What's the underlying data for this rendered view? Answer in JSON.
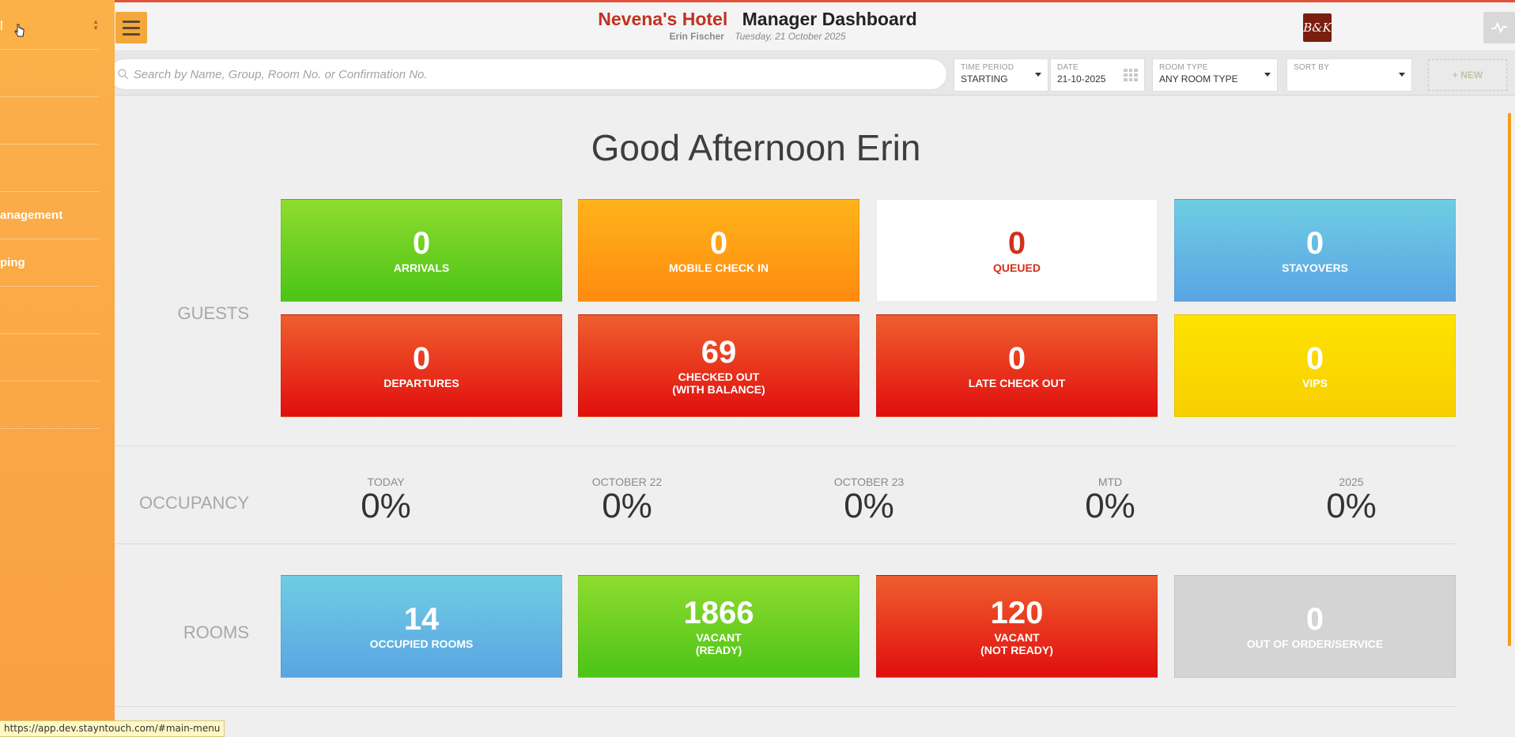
{
  "header": {
    "hotel_name": "Nevena's Hotel",
    "title": "Manager Dashboard",
    "user": "Erin Fischer",
    "date": "Tuesday, 21 October 2025",
    "logo_text": "B&K"
  },
  "toolbar": {
    "search_placeholder": "Search by Name, Group, Room No. or Confirmation No.",
    "time_period": {
      "label": "TIME PERIOD",
      "value": "STARTING"
    },
    "date": {
      "label": "DATE",
      "value": "21-10-2025"
    },
    "room_type": {
      "label": "ROOM TYPE",
      "value": "ANY ROOM TYPE"
    },
    "sort_by": {
      "label": "SORT BY",
      "value": ""
    },
    "new_label": "+ NEW"
  },
  "greeting": "Good Afternoon Erin",
  "sections": {
    "guests": "GUESTS",
    "occupancy": "OCCUPANCY",
    "rooms": "ROOMS"
  },
  "guests": [
    {
      "value": "0",
      "label": "ARRIVALS"
    },
    {
      "value": "0",
      "label": "MOBILE CHECK IN"
    },
    {
      "value": "0",
      "label": "QUEUED"
    },
    {
      "value": "0",
      "label": "STAYOVERS"
    },
    {
      "value": "0",
      "label": "DEPARTURES"
    },
    {
      "value": "69",
      "label": "CHECKED OUT",
      "label2": "(WITH BALANCE)"
    },
    {
      "value": "0",
      "label": "LATE CHECK OUT"
    },
    {
      "value": "0",
      "label": "VIPS"
    }
  ],
  "occupancy": [
    {
      "head": "TODAY",
      "value": "0%"
    },
    {
      "head": "OCTOBER 22",
      "value": "0%"
    },
    {
      "head": "OCTOBER 23",
      "value": "0%"
    },
    {
      "head": "MTD",
      "value": "0%"
    },
    {
      "head": "2025",
      "value": "0%"
    }
  ],
  "rooms": [
    {
      "value": "14",
      "label": "OCCUPIED ROOMS"
    },
    {
      "value": "1866",
      "label": "VACANT",
      "label2": "(READY)"
    },
    {
      "value": "120",
      "label": "VACANT",
      "label2": "(NOT READY)"
    },
    {
      "value": "0",
      "label": "OUT OF ORDER/SERVICE"
    }
  ],
  "sidebar": {
    "selector_text": "l",
    "items": [
      "",
      "",
      "",
      "anagement",
      "ping",
      "",
      "",
      ""
    ]
  },
  "status_url": "https://app.dev.stayntouch.com/#main-menu"
}
